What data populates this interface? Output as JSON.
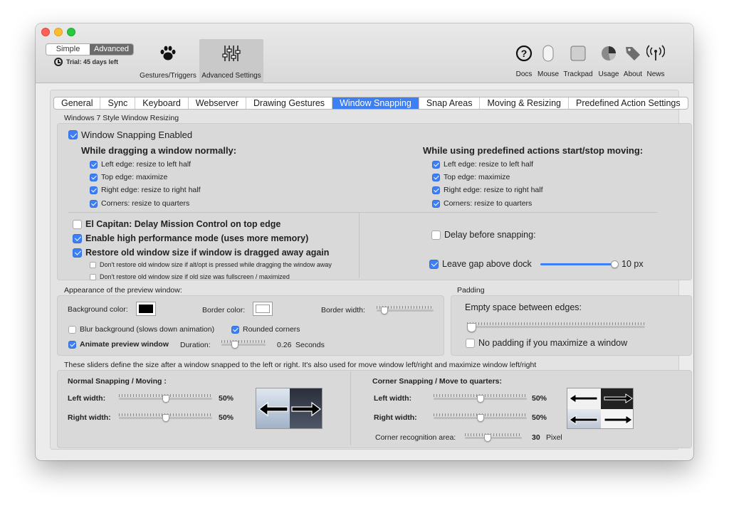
{
  "toolbar": {
    "mode_simple": "Simple",
    "mode_advanced": "Advanced",
    "trial": "Trial: 45 days left",
    "main": [
      {
        "label": "Gestures/Triggers",
        "icon": "paw-icon"
      },
      {
        "label": "Advanced Settings",
        "icon": "sliders-icon"
      }
    ],
    "right": [
      {
        "label": "Docs",
        "icon": "help-icon"
      },
      {
        "label": "Mouse",
        "icon": "mouse-icon"
      },
      {
        "label": "Trackpad",
        "icon": "trackpad-icon"
      },
      {
        "label": "Usage",
        "icon": "pie-chart-icon"
      },
      {
        "label": "About",
        "icon": "tag-icon"
      },
      {
        "label": "News",
        "icon": "antenna-icon"
      }
    ]
  },
  "tabs": [
    "General",
    "Sync",
    "Keyboard",
    "Webserver",
    "Drawing Gestures",
    "Window Snapping",
    "Snap Areas",
    "Moving & Resizing",
    "Predefined Action Settings"
  ],
  "active_tab": "Window Snapping",
  "win7": {
    "caption": "Windows 7 Style Window Resizing",
    "enabled": "Window Snapping Enabled",
    "dragging_heading": "While dragging a window normally:",
    "predefined_heading": "While using predefined actions start/stop moving:",
    "edges_left": [
      "Left edge: resize to left half",
      "Top edge: maximize",
      "Right edge: resize to right half",
      "Corners: resize to quarters"
    ],
    "edges_right": [
      "Left edge: resize to left half",
      "Top edge: maximize",
      "Right edge: resize to right half",
      "Corners: resize to quarters"
    ],
    "el_capitan": "El Capitan: Delay Mission Control on top edge",
    "high_perf": "Enable high performance mode (uses more memory)",
    "restore": "Restore old window size if window is dragged away again",
    "no_restore_alt": "Don't restore old window size if alt/opt is pressed while dragging the window away",
    "no_restore_full": "Don't restore old window size if old size was fullscreen / maximized",
    "delay": "Delay before snapping:",
    "leave_gap": "Leave gap above dock",
    "gap_value": "10 px",
    "gap_fraction": 1.0
  },
  "appearance": {
    "caption": "Appearance of the preview window:",
    "bg_color_label": "Background color:",
    "bg_color": "#000000",
    "border_color_label": "Border color:",
    "border_color": "#ffffff",
    "border_width_label": "Border width:",
    "border_width_fraction": 0.08,
    "blur": "Blur background (slows down animation)",
    "rounded": "Rounded corners",
    "animate": "Animate preview window",
    "duration_label": "Duration:",
    "duration_value": "0.26",
    "duration_unit": "Seconds",
    "duration_fraction": 0.26
  },
  "padding": {
    "caption": "Padding",
    "empty_space": "Empty space between edges:",
    "empty_fraction": 0.0,
    "no_padding": "No padding if you maximize a window"
  },
  "sizes": {
    "caption": "These sliders define the size after a window snapped to the left or right. It's also used for move window left/right and maximize window left/right",
    "normal_heading": "Normal Snapping / Moving :",
    "corner_heading": "Corner Snapping / Move to quarters:",
    "left_width_label": "Left width:",
    "right_width_label": "Right width:",
    "normal_left": "50%",
    "normal_right": "50%",
    "corner_left": "50%",
    "corner_right": "50%",
    "corner_area_label": "Corner recognition area:",
    "corner_area_value": "30",
    "corner_area_unit": "Pixel",
    "corner_area_fraction": 0.38
  }
}
